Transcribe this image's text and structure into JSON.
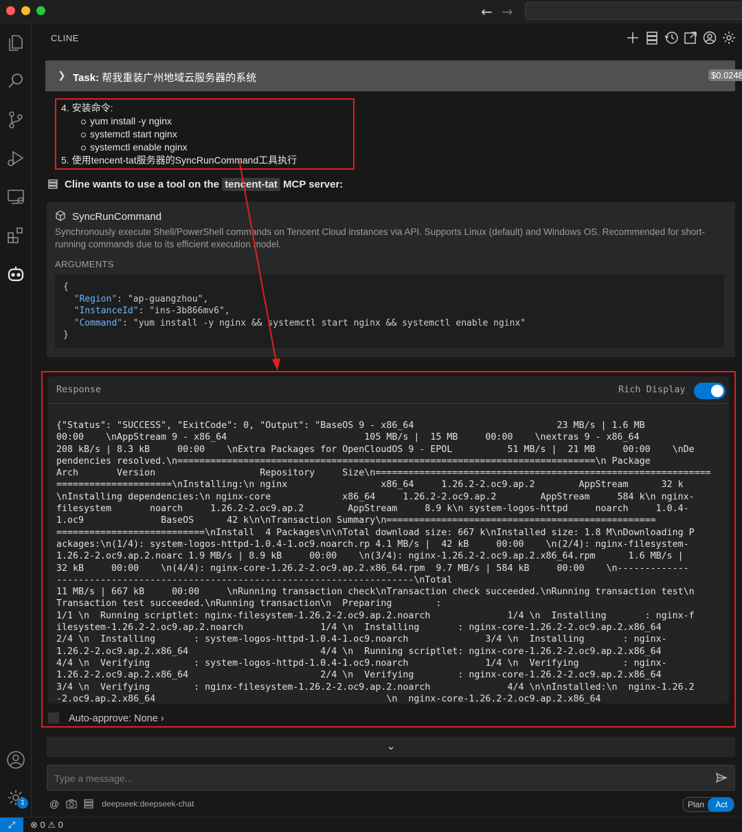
{
  "colors": {
    "accent": "#0078d4",
    "highlight": "#e02020",
    "background": "#181818"
  },
  "titlebar": {
    "nav_back": "←",
    "nav_forward": "→"
  },
  "panel": {
    "title": "CLINE"
  },
  "task": {
    "label": "Task:",
    "text": "帮我重装广州地域云服务器的系统",
    "cost": "$0.0248",
    "close": "×"
  },
  "steps": {
    "item4": "4. 安装命令:",
    "sub1": "yum install -y nginx",
    "sub2": "systemctl start nginx",
    "sub3": "systemctl enable nginx",
    "item5": "5. 使用tencent-tat服务器的SyncRunCommand工具执行"
  },
  "tool_request": {
    "prefix": "Cline wants to use a tool on the",
    "server": "tencent-tat",
    "suffix": "MCP server:"
  },
  "tool": {
    "name": "SyncRunCommand",
    "description": "Synchronously execute Shell/PowerShell commands on Tencent Cloud instances via API. Supports Linux (default) and Windows OS. Recommended for short-running commands due to its efficient execution model.",
    "args_label": "ARGUMENTS",
    "args": {
      "open": "{",
      "region_key": "\"Region\"",
      "region_val": ": \"ap-guangzhou\",",
      "instance_key": "\"InstanceId\"",
      "instance_val": ": \"ins-3b866mv6\",",
      "command_key": "\"Command\"",
      "command_val": ": \"yum install -y nginx && systemctl start nginx && systemctl enable nginx\"",
      "close": "}"
    }
  },
  "response": {
    "label": "Response",
    "rich_display_label": "Rich Display",
    "rich_display_on": true,
    "lines": [
      "{\"Status\": \"SUCCESS\", \"ExitCode\": 0, \"Output\": \"BaseOS 9 - x86_64                          23 MB/s | 1.6 MB",
      "00:00    \\nAppStream 9 - x86_64                         105 MB/s |  15 MB     00:00    \\nextras 9 - x86_64",
      "208 kB/s | 8.3 kB     00:00    \\nExtra Packages for OpenCloudOS 9 - EPOL          51 MB/s |  21 MB     00:00    \\nDe",
      "pendencies resolved.\\n============================================================================\\n Package",
      "Arch       Version                   Repository     Size\\n=============================================================",
      "=====================\\nInstalling:\\n nginx                 x86_64     1.26.2-2.oc9.ap.2        AppStream      32 k",
      "\\nInstalling dependencies:\\n nginx-core             x86_64     1.26.2-2.oc9.ap.2        AppStream     584 k\\n nginx-",
      "filesystem       noarch     1.26.2-2.oc9.ap.2        AppStream     8.9 k\\n system-logos-httpd     noarch     1.0.4-",
      "1.oc9              BaseOS      42 k\\n\\nTransaction Summary\\n=================================================",
      "===========================\\nInstall  4 Packages\\n\\nTotal download size: 667 k\\nInstalled size: 1.8 M\\nDownloading P",
      "ackages:\\n(1/4): system-logos-httpd-1.0.4-1.oc9.noarch.rp 4.1 MB/s |  42 kB     00:00    \\n(2/4): nginx-filesystem-",
      "1.26.2-2.oc9.ap.2.noarc 1.9 MB/s | 8.9 kB     00:00    \\n(3/4): nginx-1.26.2-2.oc9.ap.2.x86_64.rpm      1.6 MB/s |",
      "32 kB     00:00    \\n(4/4): nginx-core-1.26.2-2.oc9.ap.2.x86_64.rpm  9.7 MB/s | 584 kB     00:00    \\n-------------",
      "-----------------------------------------------------------------\\nTotal",
      "11 MB/s | 667 kB     00:00     \\nRunning transaction check\\nTransaction check succeeded.\\nRunning transaction test\\n",
      "Transaction test succeeded.\\nRunning transaction\\n  Preparing        :",
      "1/1 \\n  Running scriptlet: nginx-filesystem-1.26.2-2.oc9.ap.2.noarch              1/4 \\n  Installing       : nginx-f",
      "ilesystem-1.26.2-2.oc9.ap.2.noarch              1/4 \\n  Installing       : nginx-core-1.26.2-2.oc9.ap.2.x86_64",
      "2/4 \\n  Installing       : system-logos-httpd-1.0.4-1.oc9.noarch              3/4 \\n  Installing       : nginx-",
      "1.26.2-2.oc9.ap.2.x86_64                        4/4 \\n  Running scriptlet: nginx-core-1.26.2-2.oc9.ap.2.x86_64",
      "4/4 \\n  Verifying        : system-logos-httpd-1.0.4-1.oc9.noarch              1/4 \\n  Verifying        : nginx-",
      "1.26.2-2.oc9.ap.2.x86_64                        2/4 \\n  Verifying        : nginx-core-1.26.2-2.oc9.ap.2.x86_64",
      "3/4 \\n  Verifying        : nginx-filesystem-1.26.2-2.oc9.ap.2.noarch              4/4 \\n\\nInstalled:\\n  nginx-1.26.2",
      "-2.oc9.ap.2.x86_64                                          \\n  nginx-core-1.26.2-2.oc9.ap.2.x86_64"
    ],
    "auto_approve_label": "Auto-approve:",
    "auto_approve_value": "None",
    "auto_approve_chevron": "›"
  },
  "composer": {
    "scroll_down": "⌄",
    "placeholder": "Type a message...",
    "at_symbol": "@",
    "model": "deepseek:deepseek-chat",
    "plan_label": "Plan",
    "act_label": "Act"
  },
  "statusbar": {
    "remote": "⤢",
    "errors": "0",
    "warnings": "0"
  },
  "activity": {
    "settings_badge": "1"
  },
  "icons": [
    "explorer-icon",
    "search-icon",
    "source-control-icon",
    "run-debug-icon",
    "remote-explorer-icon",
    "extensions-icon",
    "cline-robot-icon",
    "account-icon",
    "settings-gear-icon",
    "plus-icon",
    "server-icon",
    "history-icon",
    "popout-icon",
    "account-circle-icon",
    "gear-icon",
    "cube-icon",
    "send-icon",
    "camera-icon"
  ]
}
